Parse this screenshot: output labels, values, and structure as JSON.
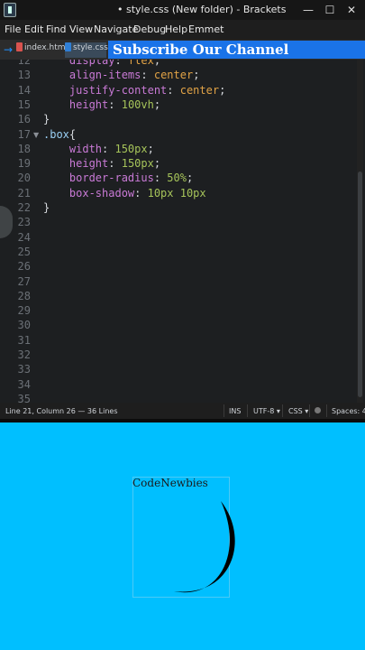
{
  "window": {
    "title": "• style.css (New folder) - Brackets",
    "controls": {
      "minimize": "—",
      "maximize": "☐",
      "close": "✕"
    }
  },
  "menu": [
    "File",
    "Edit",
    "Find",
    "View",
    "Navigate",
    "Debug",
    "Help",
    "Emmet"
  ],
  "tabs": [
    {
      "label": "index.html",
      "active": false,
      "icon": "html-file-icon"
    },
    {
      "label": "style.css",
      "active": true,
      "icon": "css-file-icon"
    }
  ],
  "banner": {
    "text": "Subscribe Our Channel"
  },
  "editor": {
    "lines": [
      {
        "n": "12",
        "tokens": [
          {
            "t": "    "
          },
          {
            "t": "display",
            "c": "prop"
          },
          {
            "t": ": "
          },
          {
            "t": "flex",
            "c": "val"
          },
          {
            "t": ";"
          }
        ]
      },
      {
        "n": "13",
        "tokens": [
          {
            "t": "    "
          },
          {
            "t": "align-items",
            "c": "prop"
          },
          {
            "t": ": "
          },
          {
            "t": "center",
            "c": "val"
          },
          {
            "t": ";"
          }
        ]
      },
      {
        "n": "14",
        "tokens": [
          {
            "t": "    "
          },
          {
            "t": "justify-content",
            "c": "prop"
          },
          {
            "t": ": "
          },
          {
            "t": "center",
            "c": "val"
          },
          {
            "t": ";"
          }
        ]
      },
      {
        "n": "15",
        "tokens": [
          {
            "t": "    "
          },
          {
            "t": "height",
            "c": "prop"
          },
          {
            "t": ": "
          },
          {
            "t": "100vh",
            "c": "num"
          },
          {
            "t": ";"
          }
        ]
      },
      {
        "n": "16",
        "tokens": [
          {
            "t": "}"
          }
        ]
      },
      {
        "n": "17",
        "fold": true,
        "tokens": [
          {
            "t": ".box",
            "c": "sel"
          },
          {
            "t": "{"
          }
        ]
      },
      {
        "n": "18",
        "tokens": [
          {
            "t": "    "
          },
          {
            "t": "width",
            "c": "prop"
          },
          {
            "t": ": "
          },
          {
            "t": "150px",
            "c": "num"
          },
          {
            "t": ";"
          }
        ]
      },
      {
        "n": "19",
        "tokens": [
          {
            "t": "    "
          },
          {
            "t": "height",
            "c": "prop"
          },
          {
            "t": ": "
          },
          {
            "t": "150px",
            "c": "num"
          },
          {
            "t": ";"
          }
        ]
      },
      {
        "n": "20",
        "tokens": [
          {
            "t": "    "
          },
          {
            "t": "border-radius",
            "c": "prop"
          },
          {
            "t": ": "
          },
          {
            "t": "50%",
            "c": "num"
          },
          {
            "t": ";"
          }
        ]
      },
      {
        "n": "21",
        "tokens": [
          {
            "t": "    "
          },
          {
            "t": "box-shadow",
            "c": "prop"
          },
          {
            "t": ": "
          },
          {
            "t": "10px 10px",
            "c": "num"
          }
        ]
      },
      {
        "n": "22",
        "tokens": [
          {
            "t": "}"
          }
        ]
      },
      {
        "n": "23",
        "tokens": []
      },
      {
        "n": "24",
        "tokens": []
      },
      {
        "n": "25",
        "tokens": []
      },
      {
        "n": "26",
        "tokens": []
      },
      {
        "n": "27",
        "tokens": []
      },
      {
        "n": "28",
        "tokens": []
      },
      {
        "n": "29",
        "tokens": []
      },
      {
        "n": "30",
        "tokens": []
      },
      {
        "n": "31",
        "tokens": []
      },
      {
        "n": "32",
        "tokens": []
      },
      {
        "n": "33",
        "tokens": []
      },
      {
        "n": "34",
        "tokens": []
      },
      {
        "n": "35",
        "tokens": []
      }
    ]
  },
  "status": {
    "position": "Line 21, Column 26 — 36 Lines",
    "mode": "INS",
    "encoding": "UTF-8",
    "language": "CSS",
    "spaces": "Spaces: 4"
  },
  "preview": {
    "label": "CodeNewbies",
    "background": "#00bfff"
  },
  "colors": {
    "banner": "#1a73e8",
    "editor_bg": "#1d1f21",
    "property": "#c97ad6",
    "value": "#e2a346",
    "number": "#a6c45a"
  }
}
